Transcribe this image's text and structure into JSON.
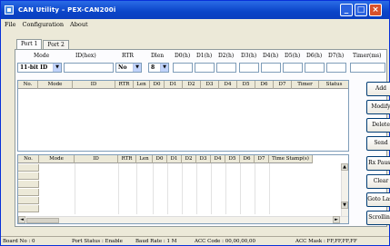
{
  "window": {
    "title": "CAN Utility – PEX-CAN200i"
  },
  "menu": [
    "File",
    "Configuration",
    "About"
  ],
  "tabs": [
    "Port 1",
    "Port 2"
  ],
  "form": {
    "labels": [
      "Mode",
      "ID(hex)",
      "RTR",
      "Dlen",
      "D0(h)",
      "D1(h)",
      "D2(h)",
      "D3(h)",
      "D4(h)",
      "D5(h)",
      "D6(h)",
      "D7(h)",
      "Timer(ms)"
    ],
    "mode_value": "11-bit ID",
    "rtr_value": "No",
    "dlen_value": "8"
  },
  "send_table": {
    "columns": [
      "No.",
      "Mode",
      "ID",
      "RTR",
      "Len",
      "D0",
      "D1",
      "D2",
      "D3",
      "D4",
      "D5",
      "D6",
      "D7",
      "Timer",
      "Status"
    ]
  },
  "recv_table": {
    "columns": [
      "No.",
      "Mode",
      "ID",
      "RTR",
      "Len",
      "D0",
      "D1",
      "D2",
      "D3",
      "D4",
      "D5",
      "D6",
      "D7",
      "Time Stamp(s)"
    ]
  },
  "buttons": {
    "add": "Add",
    "modify": "Modify",
    "delete": "Delete",
    "send": "Send",
    "rx_pause": "Rx Pause",
    "clear": "Clear",
    "goto_last": "Goto Last",
    "scrolling": "Scrolling"
  },
  "status": {
    "board_no": "Board No : 0",
    "port_status": "Port Status : Enable",
    "baud_rate": "Baud Rate : 1 M",
    "acc_code": "ACC Code : 00,00,00,00",
    "acc_mask": "ACC Mask : FF,FF,FF,FF"
  },
  "icons": [
    "app-icon",
    "minimize-icon",
    "maximize-icon",
    "close-icon",
    "dropdown-arrow-icon",
    "scroll-arrow-icon"
  ]
}
